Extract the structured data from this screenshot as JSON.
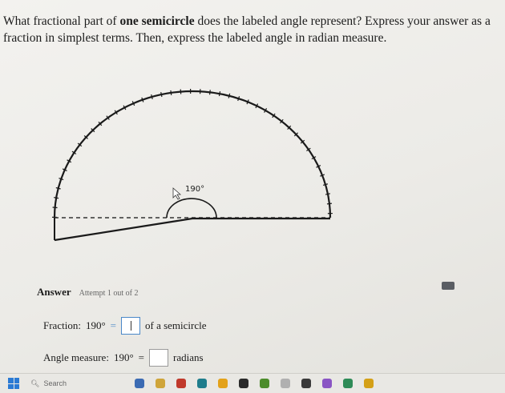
{
  "question": {
    "part1": "What fractional part of ",
    "bold": "one semicircle",
    "part2": " does the labeled angle represent? Express your answer as a fraction in simplest terms. Then, express the labeled angle in radian measure."
  },
  "diagram": {
    "angle_label": "190°"
  },
  "answer": {
    "label": "Answer",
    "attempt": "Attempt 1 out of 2"
  },
  "fraction": {
    "prefix": "Fraction:",
    "angle": "190°",
    "equals": "=",
    "suffix": "of a semicircle"
  },
  "angle_measure": {
    "prefix": "Angle measure:",
    "angle": "190°",
    "equals": "=",
    "suffix": "radians"
  },
  "taskbar": {
    "search_placeholder": "Search",
    "icons": [
      "widgets-icon",
      "task-view-icon",
      "chrome-icon",
      "edge-icon",
      "file-explorer-icon",
      "store-icon",
      "mail-icon",
      "photos-icon",
      "browser-icon",
      "app-icon",
      "app-icon-2",
      "app-icon-3"
    ]
  },
  "colors": {
    "answer_box_border": "#4a88c8",
    "windows_blue": "#2a7ad4"
  }
}
